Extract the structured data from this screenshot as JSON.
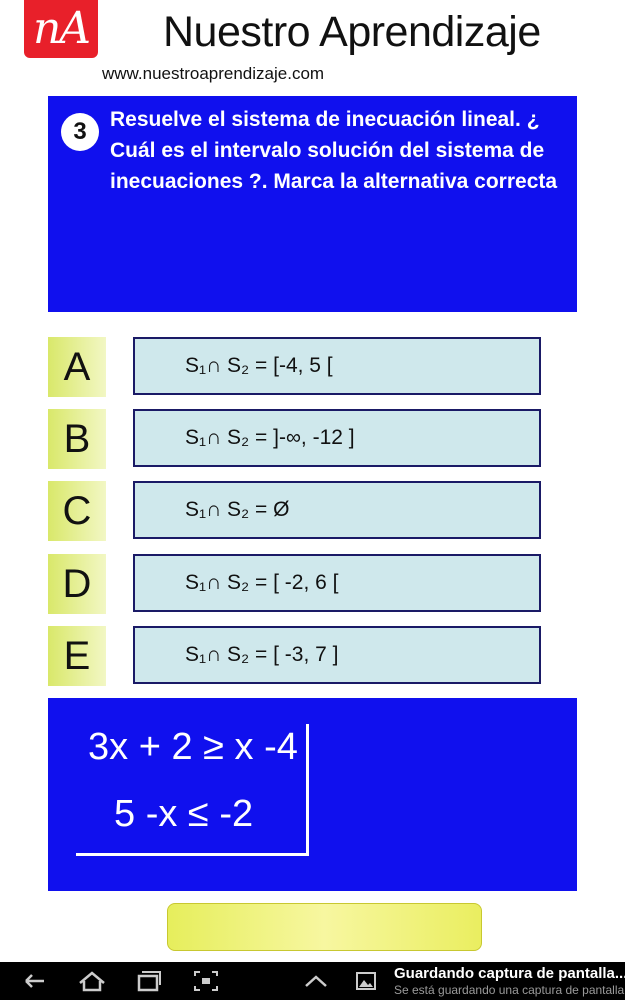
{
  "header": {
    "logo_text": "nA",
    "title": "Nuestro Aprendizaje",
    "url": "www.nuestroaprendizaje.com"
  },
  "question": {
    "number": "3",
    "text": "Resuelve el sistema de inecuación lineal. ¿ Cuál es el intervalo solución del sistema de inecuaciones ?. Marca la alternativa correcta"
  },
  "options": [
    {
      "letter": "A",
      "answer": "S₁∩ S₂ = [-4, 5 ["
    },
    {
      "letter": "B",
      "answer": "S₁∩ S₂ = ]-∞, -12 ]"
    },
    {
      "letter": "C",
      "answer": "S₁∩ S₂ =  Ø"
    },
    {
      "letter": "D",
      "answer": "S₁∩ S₂ =  [ -2, 6 ["
    },
    {
      "letter": "E",
      "answer": "S₁∩ S₂ =  [ -3, 7 ]"
    }
  ],
  "system": {
    "inequality_1": "3x + 2 ≥ x -4",
    "inequality_2": "5  -x ≤  -2"
  },
  "check_button": {
    "label": ""
  },
  "notification": {
    "title": "Guardando captura de pantalla...",
    "subtitle": "Se está guardando una captura de pantalla"
  },
  "navbar": {
    "icons": [
      "back-icon",
      "home-icon",
      "recent-apps-icon",
      "screenshot-icon",
      "chevron-up-icon",
      "image-icon"
    ]
  },
  "colors": {
    "logo_red": "#e8202a",
    "panel_blue": "#1010ee",
    "option_fill": "#cfe8ec",
    "letter_yellow": "#d9e86a"
  }
}
